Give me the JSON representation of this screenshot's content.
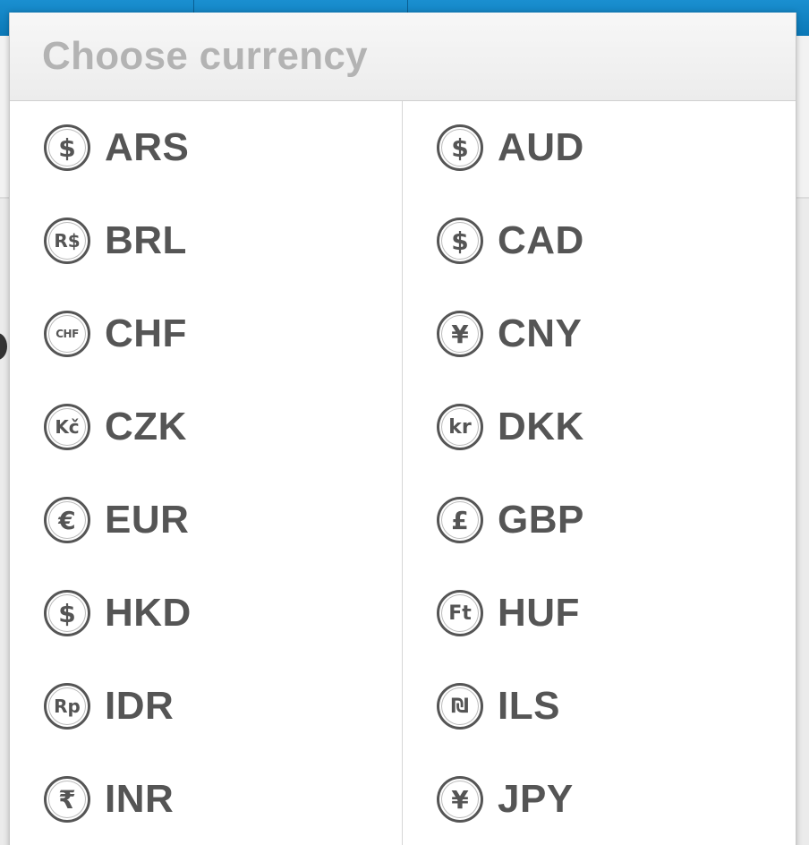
{
  "dialog": {
    "title": "Choose currency"
  },
  "currencies": [
    {
      "code": "ARS",
      "symbol": "$",
      "icon": "dollar-coin-icon"
    },
    {
      "code": "AUD",
      "symbol": "$",
      "icon": "dollar-coin-icon"
    },
    {
      "code": "BRL",
      "symbol": "R$",
      "icon": "real-coin-icon"
    },
    {
      "code": "CAD",
      "symbol": "$",
      "icon": "dollar-coin-icon"
    },
    {
      "code": "CHF",
      "symbol": "CHF",
      "icon": "franc-coin-icon"
    },
    {
      "code": "CNY",
      "symbol": "¥",
      "icon": "yuan-coin-icon"
    },
    {
      "code": "CZK",
      "symbol": "Kč",
      "icon": "koruna-coin-icon"
    },
    {
      "code": "DKK",
      "symbol": "kr",
      "icon": "krone-coin-icon"
    },
    {
      "code": "EUR",
      "symbol": "€",
      "icon": "euro-coin-icon"
    },
    {
      "code": "GBP",
      "symbol": "£",
      "icon": "pound-coin-icon"
    },
    {
      "code": "HKD",
      "symbol": "$",
      "icon": "dollar-coin-icon"
    },
    {
      "code": "HUF",
      "symbol": "Ft",
      "icon": "forint-coin-icon"
    },
    {
      "code": "IDR",
      "symbol": "Rp",
      "icon": "rupiah-coin-icon"
    },
    {
      "code": "ILS",
      "symbol": "₪",
      "icon": "shekel-coin-icon"
    },
    {
      "code": "INR",
      "symbol": "₹",
      "icon": "rupee-coin-icon"
    },
    {
      "code": "JPY",
      "symbol": "¥",
      "icon": "yen-coin-icon"
    }
  ],
  "colors": {
    "app_bar": "#0b78b6",
    "title_text": "#b3b3b3",
    "item_text": "#555555"
  }
}
